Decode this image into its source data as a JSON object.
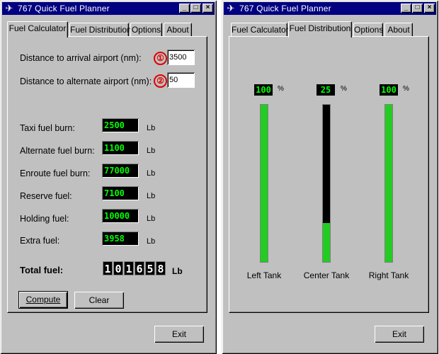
{
  "app": {
    "title": "767 Quick Fuel Planner"
  },
  "tabs": {
    "calc": "Fuel Calculator",
    "dist": "Fuel Distribution",
    "options": "Options",
    "about": "About"
  },
  "calculator": {
    "arrival_label": "Distance to arrival airport (nm):",
    "arrival_badge": "①",
    "arrival_value": "3500",
    "alternate_label": "Distance to alternate airport (nm):",
    "alternate_badge": "②",
    "alternate_value": "50",
    "rows": [
      {
        "label": "Taxi fuel burn:",
        "value": "2500",
        "unit": "Lb"
      },
      {
        "label": "Alternate fuel burn:",
        "value": "1100",
        "unit": "Lb"
      },
      {
        "label": "Enroute fuel burn:",
        "value": "77000",
        "unit": "Lb"
      },
      {
        "label": "Reserve fuel:",
        "value": "7100",
        "unit": "Lb"
      },
      {
        "label": "Holding fuel:",
        "value": "10000",
        "unit": "Lb"
      },
      {
        "label": "Extra fuel:",
        "value": "3958",
        "unit": "Lb"
      }
    ],
    "total_label": "Total fuel:",
    "total_digits": [
      "1",
      "0",
      "1",
      "6",
      "5",
      "8"
    ],
    "total_unit": "Lb",
    "compute_label": "Compute",
    "clear_label": "Clear"
  },
  "distribution": {
    "tanks": [
      {
        "name": "Left Tank",
        "percent": "100",
        "level": 1.0
      },
      {
        "name": "Center Tank",
        "percent": "25",
        "level": 0.25
      },
      {
        "name": "Right Tank",
        "percent": "100",
        "level": 1.0
      }
    ],
    "percent_symbol": "%"
  },
  "exit_label": "Exit",
  "colors": {
    "titlebar": "#000080",
    "window": "#c0c0c0",
    "led": "#00ff00",
    "tank_fill": "#22cc22"
  }
}
